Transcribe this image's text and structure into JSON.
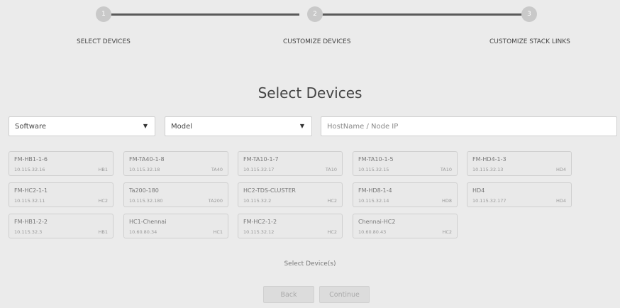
{
  "wizard": {
    "steps": [
      {
        "number": "1",
        "label": "SELECT DEVICES"
      },
      {
        "number": "2",
        "label": "CUSTOMIZE DEVICES"
      },
      {
        "number": "3",
        "label": "CUSTOMIZE STACK LINKS"
      }
    ]
  },
  "main": {
    "title": "Select Devices",
    "filters": {
      "software": {
        "value": "Software"
      },
      "model": {
        "value": "Model"
      },
      "search": {
        "placeholder": "HostName / Node IP"
      }
    },
    "devices": [
      {
        "name": "FM-HB1-1-6",
        "ip": "10.115.32.16",
        "model": "HB1"
      },
      {
        "name": "FM-TA40-1-8",
        "ip": "10.115.32.18",
        "model": "TA40"
      },
      {
        "name": "FM-TA10-1-7",
        "ip": "10.115.32.17",
        "model": "TA10"
      },
      {
        "name": "FM-TA10-1-5",
        "ip": "10.115.32.15",
        "model": "TA10"
      },
      {
        "name": "FM-HD4-1-3",
        "ip": "10.115.32.13",
        "model": "HD4"
      },
      {
        "name": "FM-HC2-1-1",
        "ip": "10.115.32.11",
        "model": "HC2"
      },
      {
        "name": "Ta200-180",
        "ip": "10.115.32.180",
        "model": "TA200"
      },
      {
        "name": "HC2-TDS-CLUSTER",
        "ip": "10.115.32.2",
        "model": "HC2"
      },
      {
        "name": "FM-HD8-1-4",
        "ip": "10.115.32.14",
        "model": "HD8"
      },
      {
        "name": "HD4",
        "ip": "10.115.32.177",
        "model": "HD4"
      },
      {
        "name": "FM-HB1-2-2",
        "ip": "10.115.32.3",
        "model": "HB1"
      },
      {
        "name": "HC1-Chennai",
        "ip": "10.60.80.34",
        "model": "HC1"
      },
      {
        "name": "FM-HC2-1-2",
        "ip": "10.115.32.12",
        "model": "HC2"
      },
      {
        "name": "Chennai-HC2",
        "ip": "10.60.80.43",
        "model": "HC2"
      }
    ],
    "hint": "Select Device(s)"
  },
  "footer": {
    "back_label": "Back",
    "continue_label": "Continue"
  },
  "colors": {
    "background": "#ebebeb",
    "step_line": "#5a5a5a",
    "step_circle": "#c9c9c9"
  }
}
